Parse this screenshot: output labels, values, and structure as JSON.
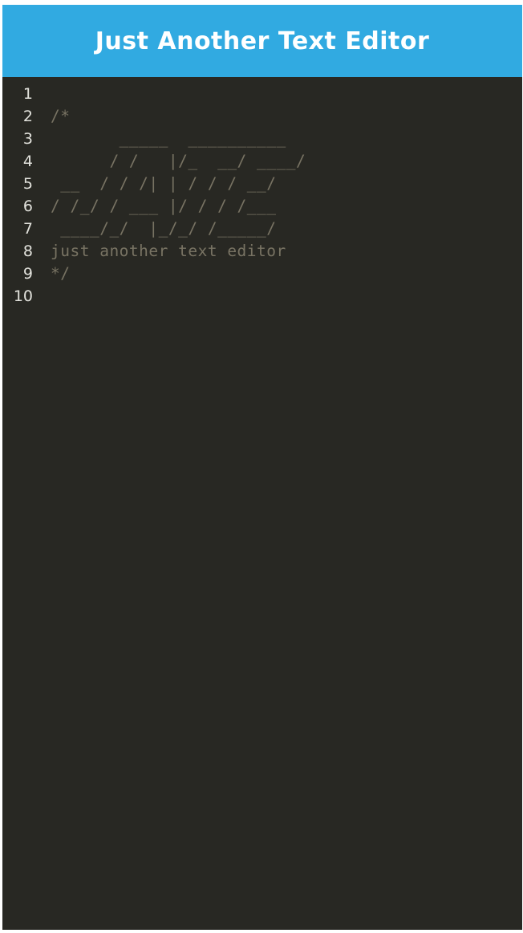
{
  "header": {
    "title": "Just Another Text Editor"
  },
  "editor": {
    "line_numbers": [
      "1",
      "2",
      "3",
      "4",
      "5",
      "6",
      "7",
      "8",
      "9",
      "10"
    ],
    "lines": [
      "",
      "/*",
      "       _____  __________",
      "      / /   |/_  __/ ____/",
      " __  / / /| | / / / __/",
      "/ /_/ / ___ |/ / / /___",
      " ____/_/  |_/_/ /_____/",
      "just another text editor",
      "*/",
      ""
    ]
  },
  "colors": {
    "header_bg": "#31aae1",
    "editor_bg": "#282823",
    "comment_text": "#787363",
    "line_number": "#e2e2dc"
  }
}
